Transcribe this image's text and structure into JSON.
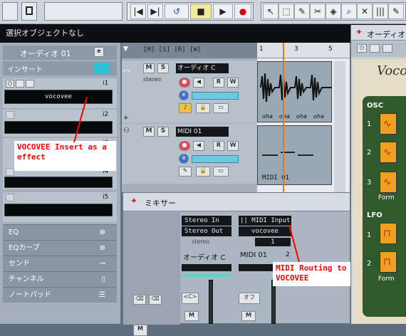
{
  "toolbar": {
    "buttons": [
      "|◀",
      "▶|",
      "↺",
      "■",
      "▶",
      "●",
      "↖",
      "⬚",
      "✎",
      "✂",
      "⌕",
      "✕",
      "|||",
      "✎"
    ]
  },
  "status": {
    "text": "選択オブジェクトなし"
  },
  "inspector": {
    "track_name": "オーディオ 01",
    "insert_label": "インサート",
    "slots": [
      {
        "num": "i1",
        "value": "vocovee"
      },
      {
        "num": "i2",
        "value": ""
      },
      {
        "num": "i3",
        "value": ""
      },
      {
        "num": "i4",
        "value": ""
      },
      {
        "num": "i5",
        "value": ""
      }
    ],
    "sections": [
      "EQ",
      "EQカーブ",
      "センド",
      "チャンネル",
      "ノートパッド"
    ]
  },
  "tracks": [
    {
      "num": "1",
      "name": "オーディオ C",
      "subtitle": "stereo"
    },
    {
      "num": "2",
      "name": "MIDI 01",
      "subtitle": ""
    }
  ],
  "timeline": {
    "markers": [
      "1",
      "3",
      "5"
    ]
  },
  "events": {
    "audio_labels": [
      "oha",
      "oha",
      "oha",
      "oha"
    ],
    "midi_label": "MIDI 01"
  },
  "mixer": {
    "title": "ミキサー",
    "stereo_in": "Stereo In",
    "stereo_out": "Stereo Out",
    "stereo_label": "stereo",
    "midi_input": "|| MIDI Input",
    "vocovee_out": "vocovee",
    "channel_1": "1",
    "ch_names": [
      "オーディオ C",
      "MIDI 01"
    ],
    "ch2_num": "2"
  },
  "vocovee": {
    "title": "オーディオ",
    "logo": "Voco",
    "osc_label": "OSC",
    "lfo_label": "LFO",
    "osc_rows": [
      "1",
      "2",
      "3"
    ],
    "lfo_rows": [
      "1",
      "2"
    ],
    "form_label": "Form"
  },
  "annotations": {
    "insert": "VOCOVEE Insert as a effect",
    "routing": "MIDI Routing to VOCOVEE"
  },
  "colors": {
    "status_bg": "#0e0f12",
    "annotation_red": "#ff0000",
    "marker_orange": "#e07a2a",
    "voco_green": "#2e5a2e"
  }
}
